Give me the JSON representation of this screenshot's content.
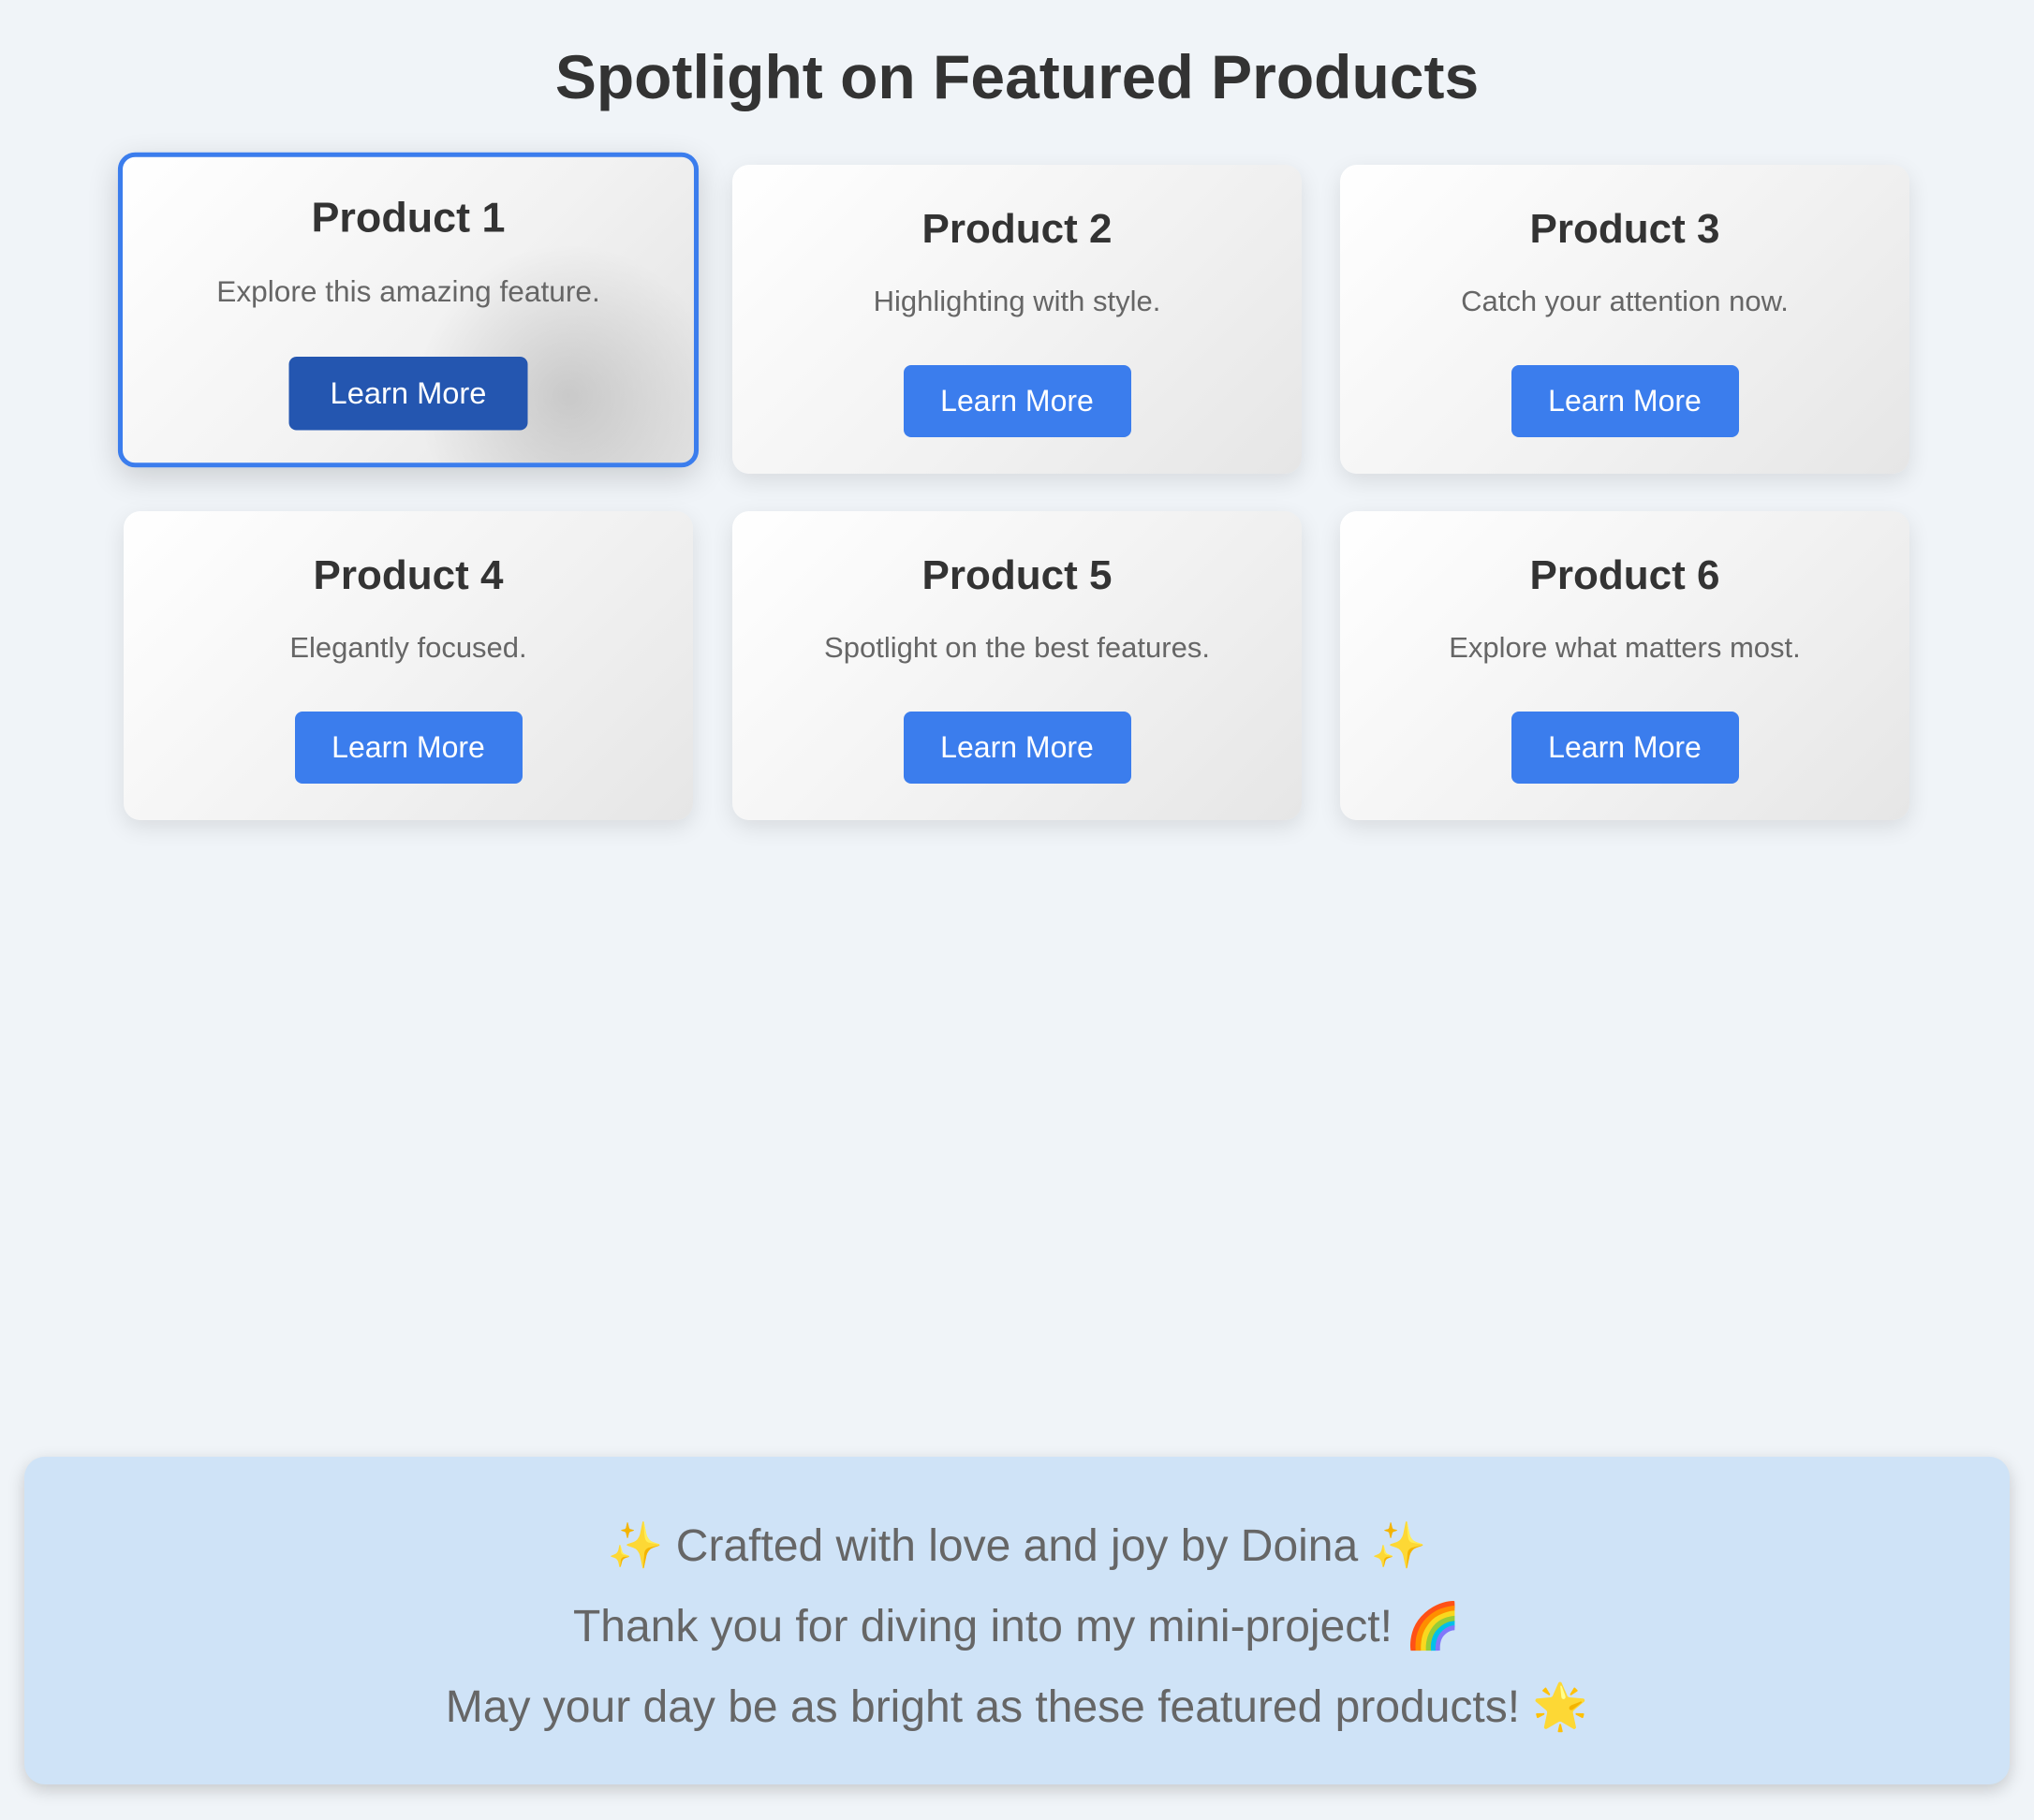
{
  "header": {
    "title": "Spotlight on Featured Products"
  },
  "products": [
    {
      "title": "Product 1",
      "description": "Explore this amazing feature.",
      "button_label": "Learn More"
    },
    {
      "title": "Product 2",
      "description": "Highlighting with style.",
      "button_label": "Learn More"
    },
    {
      "title": "Product 3",
      "description": "Catch your attention now.",
      "button_label": "Learn More"
    },
    {
      "title": "Product 4",
      "description": "Elegantly focused.",
      "button_label": "Learn More"
    },
    {
      "title": "Product 5",
      "description": "Spotlight on the best features.",
      "button_label": "Learn More"
    },
    {
      "title": "Product 6",
      "description": "Explore what matters most.",
      "button_label": "Learn More"
    }
  ],
  "footer": {
    "lines": [
      "✨ Crafted with love and joy by Doina ✨",
      "Thank you for diving into my mini-project! 🌈",
      "May your day be as bright as these featured products! 🌟"
    ]
  },
  "colors": {
    "background": "#f0f4f8",
    "accent": "#3b7ded",
    "accent_active": "#2456b0",
    "footer_background": "#cfe3f7",
    "title_text": "#333333",
    "body_text": "#666666"
  },
  "state": {
    "active_card": "Product 1"
  }
}
